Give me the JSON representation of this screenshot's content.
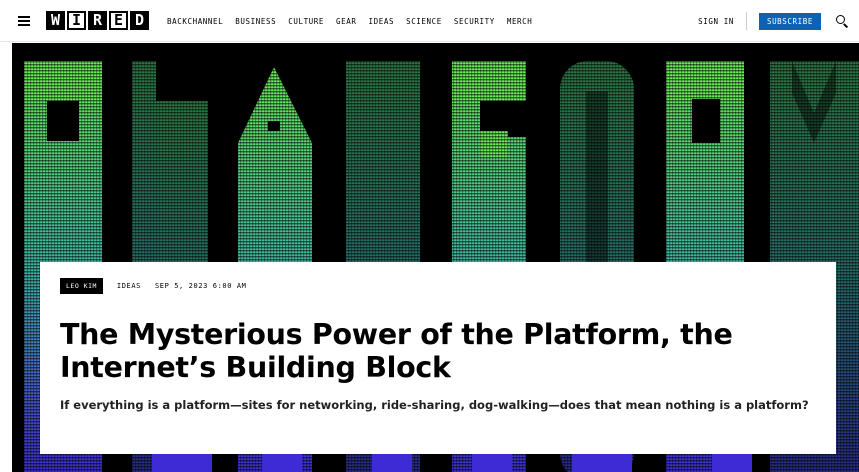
{
  "nav": {
    "logo_letters": [
      "W",
      "I",
      "R",
      "E",
      "D"
    ],
    "links": [
      "BACKCHANNEL",
      "BUSINESS",
      "CULTURE",
      "GEAR",
      "IDEAS",
      "SCIENCE",
      "SECURITY",
      "MERCH"
    ],
    "sign_in": "SIGN IN",
    "subscribe": "SUBSCRIBE",
    "subscribe_color": "#0c63b4"
  },
  "hero": {
    "colors": {
      "green": "#6df05c",
      "teal": "#3fb8a8",
      "blue": "#3d2bd6",
      "background": "#000000"
    }
  },
  "article": {
    "author": "LEO KIM",
    "section": "IDEAS",
    "date": "SEP 5, 2023 6:00 AM",
    "headline": "The Mysterious Power of the Platform, the Internet’s Building Block",
    "dek": "If everything is a platform—sites for networking, ride-sharing, dog-walking—does that mean nothing is a platform?"
  }
}
